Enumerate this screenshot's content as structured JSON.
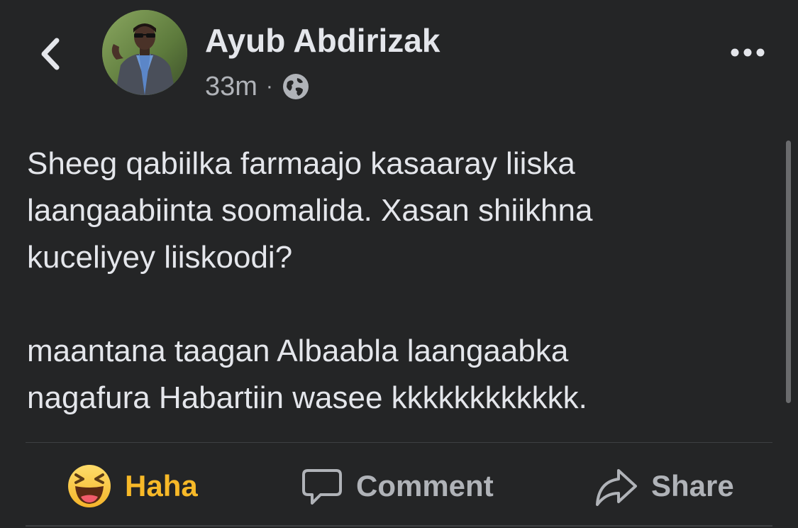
{
  "header": {
    "back_icon": "chevron-left-icon",
    "author_name": "Ayub Abdirizak",
    "timestamp": "33m",
    "separator": "·",
    "audience_icon": "globe-icon",
    "more_icon": "more-horizontal-icon"
  },
  "post": {
    "paragraph_1": "Sheeg qabiilka farmaajo kasaaray liiska\nlaangaabiinta soomalida. Xasan shiikhna\nkuceliyey liiskoodi?",
    "paragraph_2": "maantana taagan Albaabla laangaabka\nnagafura Habartiin wasee kkkkkkkkkkkk."
  },
  "actions": {
    "haha_label": "Haha",
    "comment_label": "Comment",
    "share_label": "Share"
  },
  "colors": {
    "background": "#242526",
    "text_primary": "#e4e6eb",
    "text_secondary": "#b0b3b8",
    "haha_accent": "#f7b928"
  }
}
